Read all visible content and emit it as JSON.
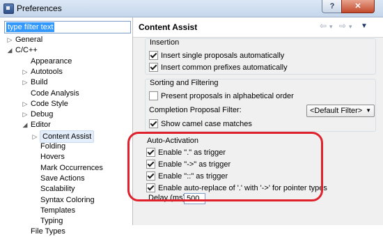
{
  "window": {
    "title": "Preferences",
    "help_label": "?",
    "close_label": "✕"
  },
  "filter": {
    "value": "type filter text"
  },
  "tree": [
    {
      "label": "General",
      "twisty": "▷"
    },
    {
      "label": "C/C++",
      "twisty": "◢"
    },
    {
      "label": "Appearance",
      "twisty": ""
    },
    {
      "label": "Autotools",
      "twisty": "▷"
    },
    {
      "label": "Build",
      "twisty": "▷"
    },
    {
      "label": "Code Analysis",
      "twisty": ""
    },
    {
      "label": "Code Style",
      "twisty": "▷"
    },
    {
      "label": "Debug",
      "twisty": "▷"
    },
    {
      "label": "Editor",
      "twisty": "◢"
    },
    {
      "label": "Content Assist",
      "twisty": "▷",
      "selected": true
    },
    {
      "label": "Folding",
      "twisty": ""
    },
    {
      "label": "Hovers",
      "twisty": ""
    },
    {
      "label": "Mark Occurrences",
      "twisty": ""
    },
    {
      "label": "Save Actions",
      "twisty": ""
    },
    {
      "label": "Scalability",
      "twisty": ""
    },
    {
      "label": "Syntax Coloring",
      "twisty": ""
    },
    {
      "label": "Templates",
      "twisty": ""
    },
    {
      "label": "Typing",
      "twisty": ""
    },
    {
      "label": "File Types",
      "twisty": ""
    }
  ],
  "page": {
    "title": "Content Assist",
    "nav": {
      "back": "⇦",
      "back_menu": "▾",
      "forward": "⇨",
      "forward_menu": "▾",
      "menu": "▼"
    },
    "insertion": {
      "label": "Insertion",
      "items": [
        {
          "label": "Insert single proposals automatically",
          "checked": true
        },
        {
          "label": "Insert common prefixes automatically",
          "checked": true
        }
      ]
    },
    "sorting": {
      "label": "Sorting and Filtering",
      "present_alpha": {
        "label": "Present proposals in alphabetical order",
        "checked": false
      },
      "filter_label": "Completion Proposal Filter:",
      "filter_value": "<Default Filter>",
      "camel": {
        "label": "Show camel case matches",
        "checked": true
      }
    },
    "auto_activation": {
      "label": "Auto-Activation",
      "items": [
        {
          "label": "Enable \".\" as trigger",
          "checked": true
        },
        {
          "label": "Enable \"->\" as trigger",
          "checked": true
        },
        {
          "label": "Enable \"::\" as trigger",
          "checked": true
        },
        {
          "label": "Enable auto-replace of '.' with '->' for pointer types",
          "checked": true
        }
      ]
    },
    "delay": {
      "label": "Delay (ms)",
      "value": "500"
    }
  },
  "colors": {
    "highlight": "#e0202a",
    "selection": "#3399ff"
  }
}
